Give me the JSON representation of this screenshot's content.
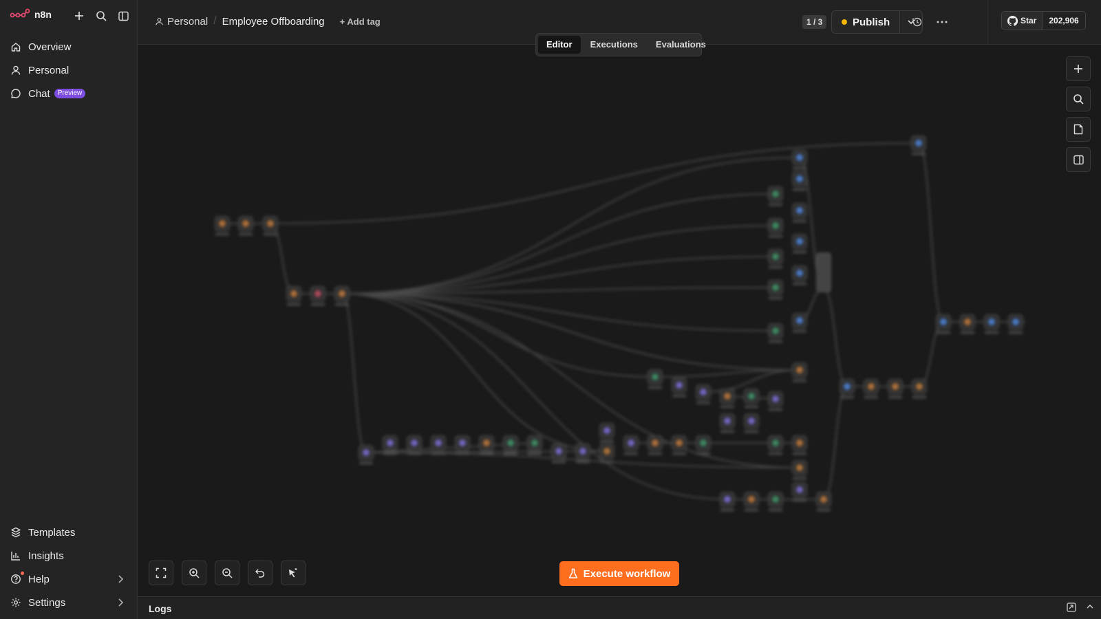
{
  "app": {
    "logo_text": "n8n"
  },
  "sidebar": {
    "nav": [
      {
        "label": "Overview",
        "icon": "home-icon"
      },
      {
        "label": "Personal",
        "icon": "user-icon"
      },
      {
        "label": "Chat",
        "icon": "chat-icon",
        "badge": "Preview"
      }
    ],
    "bottom": [
      {
        "label": "Templates",
        "icon": "templates-icon"
      },
      {
        "label": "Insights",
        "icon": "insights-icon"
      },
      {
        "label": "Help",
        "icon": "help-icon"
      },
      {
        "label": "Settings",
        "icon": "gear-icon"
      }
    ]
  },
  "header": {
    "project": "Personal",
    "workflow_title": "Employee Offboarding",
    "add_tag": "+ Add tag",
    "counter": "1 / 3",
    "publish_label": "Publish",
    "github_star": "Star",
    "github_count": "202,906"
  },
  "tabs": [
    "Editor",
    "Executions",
    "Evaluations"
  ],
  "active_tab": "Editor",
  "canvas": {
    "execute_label": "Execute workflow"
  },
  "logs": {
    "label": "Logs"
  },
  "colors": {
    "accent": "#ff6d1f",
    "publish_dot": "#f5b400",
    "preview_badge": "#7c4dde"
  }
}
